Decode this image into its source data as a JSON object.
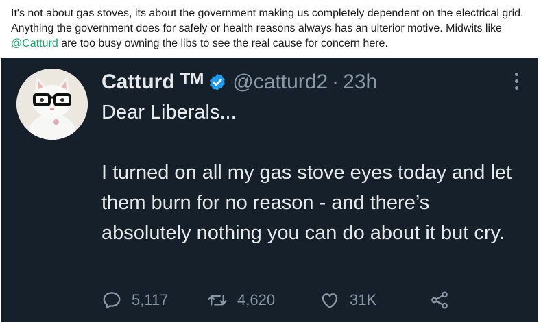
{
  "post": {
    "text_before": "It's not about gas stoves, its about the government making us completely dependent on the electrical grid. Anything the government does for safely or health reasons always has an ulterior motive. Midwits like ",
    "mention": "@Catturd",
    "text_after": " are too busy owning the libs to see the real cause for concern here."
  },
  "tweet": {
    "display_name": "Catturd",
    "tm": "TM",
    "handle": "@catturd2",
    "separator": "·",
    "time": "23h",
    "lines": [
      "Dear Liberals...",
      "I turned on all my gas stove eyes today and let them burn for no reason - and there’s absolutely nothing you can do about it but cry."
    ],
    "replies": "5,117",
    "retweets": "4,620",
    "likes": "31K"
  },
  "colors": {
    "tweet_bg": "#15202b",
    "mention": "#1aa86a",
    "verified": "#1d9bf0",
    "muted": "#8b98a5"
  },
  "icons": [
    "verified-badge-icon",
    "more-options-icon",
    "reply-icon",
    "retweet-icon",
    "like-icon",
    "share-icon"
  ]
}
